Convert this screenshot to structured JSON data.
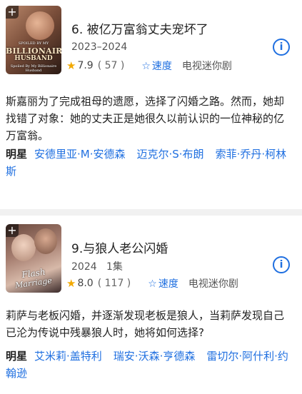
{
  "items": [
    {
      "title": "6. 被亿万富翁丈夫宠坏了",
      "year": "2023–2024",
      "rating": "7.9",
      "rating_count": "( 57 )",
      "speed_label": "速度",
      "genre": "电视迷你剧",
      "poster_text": [
        "SPOILED BY MY",
        "BILLIONAIRE",
        "HUSBAND",
        "Spoiled By My Billionaire Husband"
      ],
      "description": "斯嘉丽为了完成祖母的遗愿，选择了闪婚之路。然而，她却找错了对象：她的丈夫正是她很久以前认识的一位神秘的亿万富翁。",
      "cast_label": "明星",
      "cast": [
        "安德里亚·M·安德森",
        "迈克尔·S·布朗",
        "索菲·乔丹·柯林斯"
      ]
    },
    {
      "title": "9.与狼人老公闪婚",
      "year": "2024",
      "episodes": "1集",
      "rating": "8.0",
      "rating_count": "( 117 )",
      "speed_label": "速度",
      "genre": "电视迷你剧",
      "poster_text": [
        "Flash",
        "Marriage"
      ],
      "description": "莉萨与老板闪婚，并逐渐发现老板是狼人，当莉萨发现自己已沦为传说中残暴狼人时，她将如何选择?",
      "cast_label": "明星",
      "cast": [
        "艾米莉·盖特利",
        "瑞安·沃森·亨德森",
        "雷切尔·阿什利·约翰逊"
      ]
    }
  ],
  "icons": {
    "add": "plus-icon",
    "rating": "star-icon",
    "rate": "star-outline-icon",
    "info": "info-icon"
  },
  "colors": {
    "accent": "#1f6fe0",
    "star": "#f2a900"
  }
}
